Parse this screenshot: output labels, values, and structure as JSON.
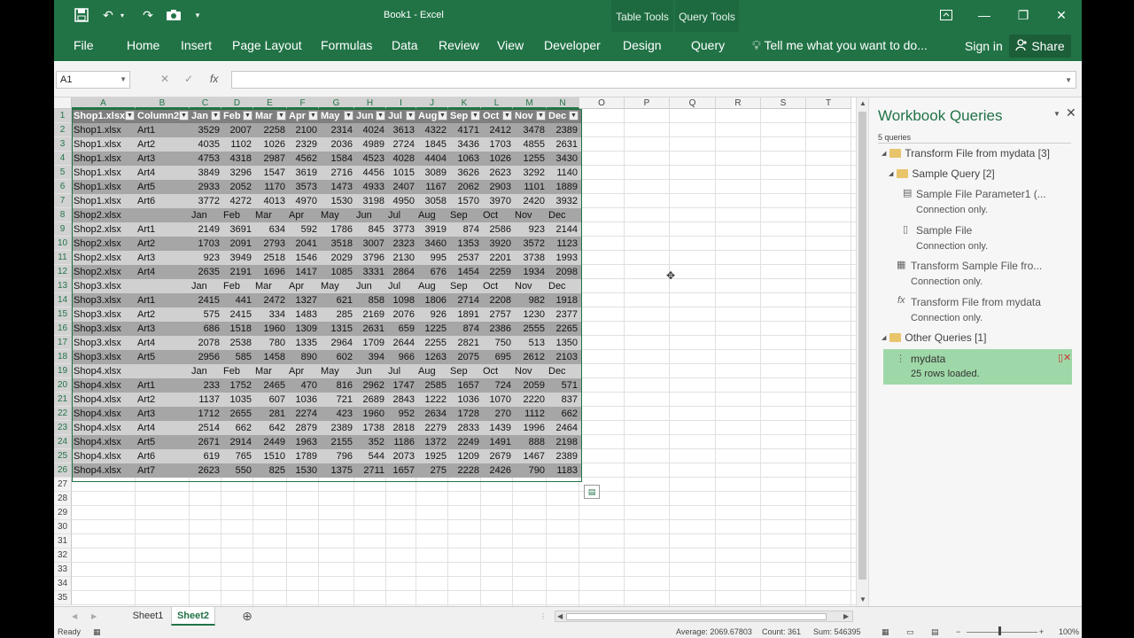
{
  "window": {
    "title": "Book1 - Excel",
    "context_groups": [
      "Table Tools",
      "Query Tools"
    ]
  },
  "ribbon": {
    "tabs": [
      "File",
      "Home",
      "Insert",
      "Page Layout",
      "Formulas",
      "Data",
      "Review",
      "View",
      "Developer",
      "Design",
      "Query"
    ],
    "tell_me": "Tell me what you want to do...",
    "sign_in": "Sign in",
    "share": "Share"
  },
  "formula_bar": {
    "name_box": "A1",
    "fx": "fx",
    "value": ""
  },
  "grid": {
    "columns": [
      "A",
      "B",
      "C",
      "D",
      "E",
      "F",
      "G",
      "H",
      "I",
      "J",
      "K",
      "L",
      "M",
      "N",
      "O",
      "P",
      "Q",
      "R",
      "S",
      "T"
    ],
    "row_numbers": [
      "1",
      "2",
      "3",
      "4",
      "5",
      "6",
      "7",
      "8",
      "9",
      "10",
      "11",
      "12",
      "13",
      "14",
      "15",
      "16",
      "17",
      "18",
      "19",
      "20",
      "21",
      "22",
      "23",
      "24",
      "25",
      "26",
      "27",
      "28",
      "29",
      "30",
      "31",
      "32",
      "33",
      "34",
      "35"
    ],
    "header": [
      "Shop1.xlsx",
      "Column2",
      "Jan",
      "Feb",
      "Mar",
      "Apr",
      "May",
      "Jun",
      "Jul",
      "Aug",
      "Sep",
      "Oct",
      "Nov",
      "Dec"
    ],
    "rows": [
      [
        "Shop1.xlsx",
        "Art1",
        "3529",
        "2007",
        "2258",
        "2100",
        "2314",
        "4024",
        "3613",
        "4322",
        "4171",
        "2412",
        "3478",
        "2389"
      ],
      [
        "Shop1.xlsx",
        "Art2",
        "4035",
        "1102",
        "1026",
        "2329",
        "2036",
        "4989",
        "2724",
        "1845",
        "3436",
        "1703",
        "4855",
        "2631"
      ],
      [
        "Shop1.xlsx",
        "Art3",
        "4753",
        "4318",
        "2987",
        "4562",
        "1584",
        "4523",
        "4028",
        "4404",
        "1063",
        "1026",
        "1255",
        "3430"
      ],
      [
        "Shop1.xlsx",
        "Art4",
        "3849",
        "3296",
        "1547",
        "3619",
        "2716",
        "4456",
        "1015",
        "3089",
        "3626",
        "2623",
        "3292",
        "1140"
      ],
      [
        "Shop1.xlsx",
        "Art5",
        "2933",
        "2052",
        "1170",
        "3573",
        "1473",
        "4933",
        "2407",
        "1167",
        "2062",
        "2903",
        "1101",
        "1889"
      ],
      [
        "Shop1.xlsx",
        "Art6",
        "3772",
        "4272",
        "4013",
        "4970",
        "1530",
        "3198",
        "4950",
        "3058",
        "1570",
        "3970",
        "2420",
        "3932"
      ],
      [
        "Shop2.xlsx",
        "",
        "Jan",
        "Feb",
        "Mar",
        "Apr",
        "May",
        "Jun",
        "Jul",
        "Aug",
        "Sep",
        "Oct",
        "Nov",
        "Dec"
      ],
      [
        "Shop2.xlsx",
        "Art1",
        "2149",
        "3691",
        "634",
        "592",
        "1786",
        "845",
        "3773",
        "3919",
        "874",
        "2586",
        "923",
        "2144"
      ],
      [
        "Shop2.xlsx",
        "Art2",
        "1703",
        "2091",
        "2793",
        "2041",
        "3518",
        "3007",
        "2323",
        "3460",
        "1353",
        "3920",
        "3572",
        "1123"
      ],
      [
        "Shop2.xlsx",
        "Art3",
        "923",
        "3949",
        "2518",
        "1546",
        "2029",
        "3796",
        "2130",
        "995",
        "2537",
        "2201",
        "3738",
        "1993"
      ],
      [
        "Shop2.xlsx",
        "Art4",
        "2635",
        "2191",
        "1696",
        "1417",
        "1085",
        "3331",
        "2864",
        "676",
        "1454",
        "2259",
        "1934",
        "2098"
      ],
      [
        "Shop3.xlsx",
        "",
        "Jan",
        "Feb",
        "Mar",
        "Apr",
        "May",
        "Jun",
        "Jul",
        "Aug",
        "Sep",
        "Oct",
        "Nov",
        "Dec"
      ],
      [
        "Shop3.xlsx",
        "Art1",
        "2415",
        "441",
        "2472",
        "1327",
        "621",
        "858",
        "1098",
        "1806",
        "2714",
        "2208",
        "982",
        "1918"
      ],
      [
        "Shop3.xlsx",
        "Art2",
        "575",
        "2415",
        "334",
        "1483",
        "285",
        "2169",
        "2076",
        "926",
        "1891",
        "2757",
        "1230",
        "2377"
      ],
      [
        "Shop3.xlsx",
        "Art3",
        "686",
        "1518",
        "1960",
        "1309",
        "1315",
        "2631",
        "659",
        "1225",
        "874",
        "2386",
        "2555",
        "2265"
      ],
      [
        "Shop3.xlsx",
        "Art4",
        "2078",
        "2538",
        "780",
        "1335",
        "2964",
        "1709",
        "2644",
        "2255",
        "2821",
        "750",
        "513",
        "1350"
      ],
      [
        "Shop3.xlsx",
        "Art5",
        "2956",
        "585",
        "1458",
        "890",
        "602",
        "394",
        "966",
        "1263",
        "2075",
        "695",
        "2612",
        "2103"
      ],
      [
        "Shop4.xlsx",
        "",
        "Jan",
        "Feb",
        "Mar",
        "Apr",
        "May",
        "Jun",
        "Jul",
        "Aug",
        "Sep",
        "Oct",
        "Nov",
        "Dec"
      ],
      [
        "Shop4.xlsx",
        "Art1",
        "233",
        "1752",
        "2465",
        "470",
        "816",
        "2962",
        "1747",
        "2585",
        "1657",
        "724",
        "2059",
        "571"
      ],
      [
        "Shop4.xlsx",
        "Art2",
        "1137",
        "1035",
        "607",
        "1036",
        "721",
        "2689",
        "2843",
        "1222",
        "1036",
        "1070",
        "2220",
        "837"
      ],
      [
        "Shop4.xlsx",
        "Art3",
        "1712",
        "2655",
        "281",
        "2274",
        "423",
        "1960",
        "952",
        "2634",
        "1728",
        "270",
        "1112",
        "662"
      ],
      [
        "Shop4.xlsx",
        "Art4",
        "2514",
        "662",
        "642",
        "2879",
        "2389",
        "1738",
        "2818",
        "2279",
        "2833",
        "1439",
        "1996",
        "2464"
      ],
      [
        "Shop4.xlsx",
        "Art5",
        "2671",
        "2914",
        "2449",
        "1963",
        "2155",
        "352",
        "1186",
        "1372",
        "2249",
        "1491",
        "888",
        "2198"
      ],
      [
        "Shop4.xlsx",
        "Art6",
        "619",
        "765",
        "1510",
        "1789",
        "796",
        "544",
        "2073",
        "1925",
        "1209",
        "2679",
        "1467",
        "2389"
      ],
      [
        "Shop4.xlsx",
        "Art7",
        "2623",
        "550",
        "825",
        "1530",
        "1375",
        "2711",
        "1657",
        "275",
        "2228",
        "2426",
        "790",
        "1183"
      ]
    ]
  },
  "pane": {
    "title": "Workbook Queries",
    "count": "5 queries",
    "groups": {
      "transform": "Transform File from mydata [3]",
      "sample": "Sample Query [2]",
      "other": "Other Queries [1]"
    },
    "items": [
      {
        "name": "Sample File Parameter1 (...",
        "status": "Connection only."
      },
      {
        "name": "Sample File",
        "status": "Connection only."
      },
      {
        "name": "Transform Sample File fro...",
        "status": "Connection only."
      },
      {
        "name": "Transform File from mydata",
        "status": "Connection only."
      },
      {
        "name": "mydata",
        "status": "25 rows loaded."
      }
    ]
  },
  "sheets": [
    "Sheet1",
    "Sheet2"
  ],
  "status": {
    "mode": "Ready",
    "average": "Average: 2069.67803",
    "count": "Count: 361",
    "sum": "Sum: 546395",
    "zoom": "100%"
  },
  "colors": {
    "accent": "#217346",
    "selected_query": "#9fd8a8"
  }
}
